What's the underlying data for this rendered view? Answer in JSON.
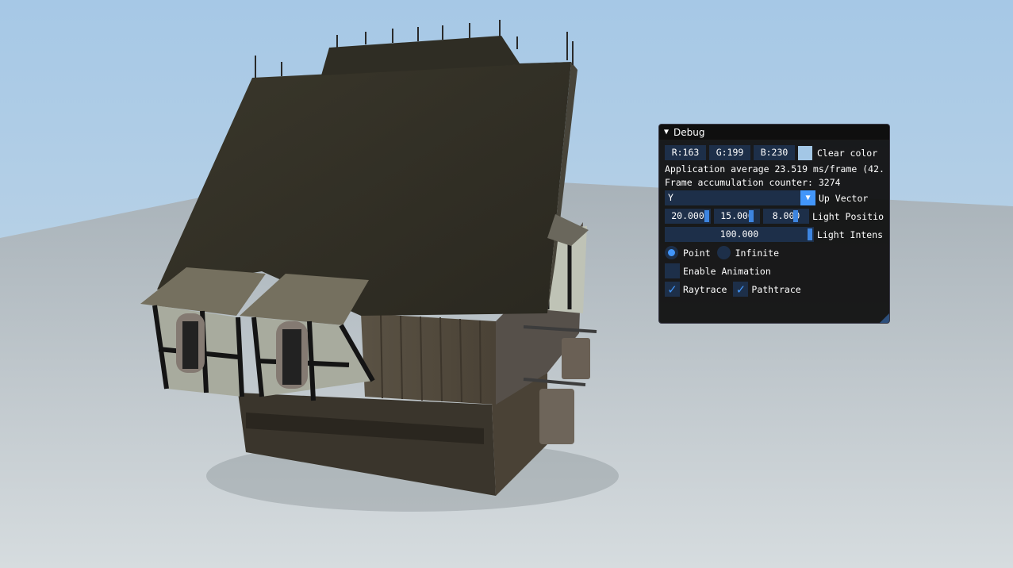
{
  "debug": {
    "title": "Debug",
    "clear_color": {
      "r_label": "R:163",
      "g_label": "G:199",
      "b_label": "B:230",
      "swatch_color": "#a3c7e6",
      "label": "Clear color"
    },
    "app_average": "Application average 23.519 ms/frame (42.",
    "frame_counter": "Frame accumulation counter: 3274",
    "up_vector": {
      "value": "Y",
      "label": "Up Vector"
    },
    "light_position": {
      "x": "20.000",
      "y": "15.000",
      "z": "8.000",
      "label": "Light Positio"
    },
    "light_intensity": {
      "value": "100.000",
      "label": "Light Intens"
    },
    "light_type": {
      "point_label": "Point",
      "infinite_label": "Infinite",
      "selected": "Point"
    },
    "enable_animation": {
      "label": "Enable Animation",
      "checked": false
    },
    "raytrace": {
      "label": "Raytrace",
      "checked": true
    },
    "pathtrace": {
      "label": "Pathtrace",
      "checked": true
    }
  },
  "icons": {
    "collapse": "triangle-down-icon",
    "combo": "triangle-down-icon",
    "check": "checkmark-icon"
  },
  "colors": {
    "sky": "#a3c7e6",
    "frame_bg": "#1d2f49",
    "accent": "#4296fa"
  }
}
